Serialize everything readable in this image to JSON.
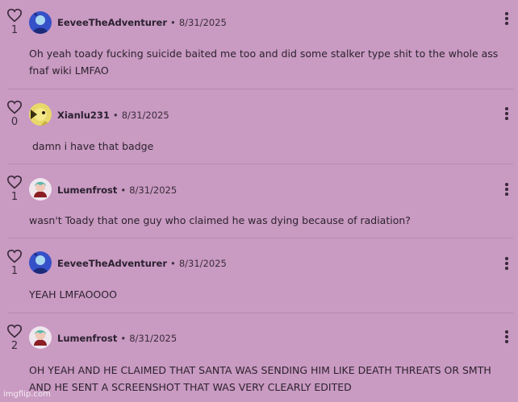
{
  "comments": [
    {
      "user": "EeveeTheAdventurer",
      "date": "8/31/2025",
      "likes": "1",
      "avatar": "eevee",
      "text": "Oh yeah toady fucking suicide baited me too and did some stalker type shit to the whole ass fnaf wiki LMFAO"
    },
    {
      "user": "Xianlu231",
      "date": "8/31/2025",
      "likes": "0",
      "avatar": "xianlu",
      "text": "damn i have that badge"
    },
    {
      "user": "Lumenfrost",
      "date": "8/31/2025",
      "likes": "1",
      "avatar": "lumen",
      "text": "wasn't Toady that one guy who claimed he was dying because of radiation?"
    },
    {
      "user": "EeveeTheAdventurer",
      "date": "8/31/2025",
      "likes": "1",
      "avatar": "eevee",
      "text": "YEAH LMFAOOOO"
    },
    {
      "user": "Lumenfrost",
      "date": "8/31/2025",
      "likes": "2",
      "avatar": "lumen",
      "text": "OH YEAH AND HE CLAIMED THAT SANTA WAS SENDING HIM LIKE DEATH THREATS OR SMTH AND HE SENT A SCREENSHOT THAT WAS VERY CLEARLY EDITED"
    }
  ],
  "separator": "•",
  "watermark": "imgflip.com",
  "colors": {
    "background": "#c99ac2",
    "divider": "#b68aaf",
    "text": "#2d232e"
  },
  "icons": {
    "like": "heart-outline-icon",
    "menu": "kebab-menu-icon"
  }
}
